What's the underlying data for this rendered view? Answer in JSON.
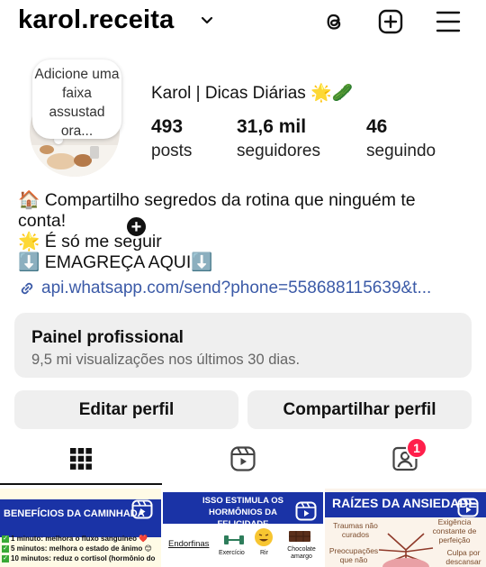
{
  "header": {
    "username": "karol.receita",
    "icons": [
      "chevron-down-icon",
      "threads-icon",
      "new-post-icon",
      "menu-icon"
    ]
  },
  "profile": {
    "note_text": "Adicione uma faixa assustad ora...",
    "display_name": "Karol | Dicas Diárias 🌟🥒",
    "stats": [
      {
        "value": "493",
        "label": "posts"
      },
      {
        "value": "31,6 mil",
        "label": "seguidores"
      },
      {
        "value": "46",
        "label": "seguindo"
      }
    ]
  },
  "bio": {
    "lines": [
      "🏠 Compartilho segredos da rotina que ninguém te",
      "conta!",
      "🌟 É só me seguir",
      "⬇️ EMAGREÇA AQUI⬇️"
    ],
    "link": "api.whatsapp.com/send?phone=558688115639&t..."
  },
  "professional_panel": {
    "title": "Painel profissional",
    "subtitle": "9,5 mi visualizações nos últimos 30 dias."
  },
  "buttons": {
    "edit": "Editar perfil",
    "share": "Compartilhar perfil"
  },
  "tabs": {
    "items": [
      "grid-icon",
      "reels-icon",
      "tagged-icon"
    ],
    "active": 0,
    "tagged_badge": "1"
  },
  "posts": [
    {
      "title": "BENEFÍCIOS DA CAMINHADA",
      "items": [
        "1 minuto: melhora o fluxo sanguíneo ❤️",
        "5 minutos: melhora o estado de ânimo 😊",
        "10 minutos: reduz o cortisol (hormônio do"
      ]
    },
    {
      "title": "ISSO ESTIMULA OS HORMÔNIOS DA FELICIDADE",
      "labels": [
        "Endorfinas",
        "Exercício",
        "Rir",
        "Chocolate amargo"
      ]
    },
    {
      "title": "RAÍZES DA ANSIEDADE",
      "labels": [
        "Traumas não curados",
        "Exigência constante de perfeição",
        "Preocupações que não cessam",
        "Culpa por descansar"
      ]
    }
  ],
  "colors": {
    "link": "#3b5aa7",
    "button_bg": "#efefef",
    "badge": "#ff1f4b",
    "post_banner": "#1a33a6"
  }
}
